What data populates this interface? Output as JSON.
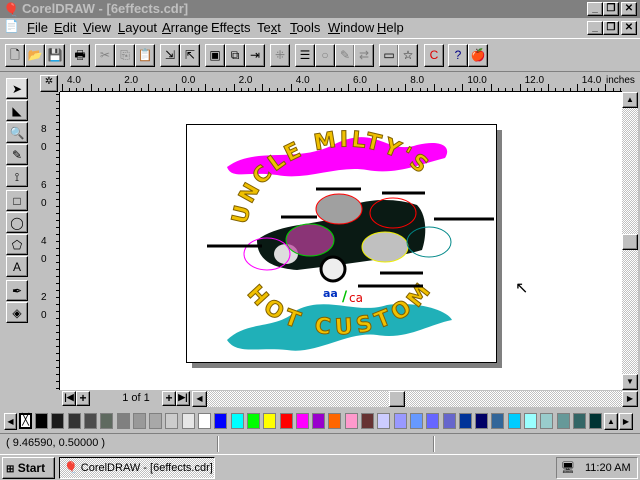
{
  "window": {
    "title": "CorelDRAW - [6effects.cdr]"
  },
  "menu": [
    "File",
    "Edit",
    "View",
    "Layout",
    "Arrange",
    "Effects",
    "Text",
    "Tools",
    "Window",
    "Help"
  ],
  "menu_underline": [
    "F",
    "E",
    "V",
    "L",
    "A",
    "c",
    "x",
    "T",
    "W",
    "H"
  ],
  "toolbar": [
    "new-icon",
    "open-icon",
    "save-icon",
    "print-icon",
    "cut-icon",
    "copy-icon",
    "paste-icon",
    "import-icon",
    "export-icon",
    "wireframe-icon",
    "full-screen-preview-icon",
    "preview-selected-icon",
    "snap-to-grid-icon",
    "roll-up-icon",
    "ellipse-roll-up-icon",
    "pen-roll-up-icon",
    "transform-roll-up-icon",
    "dialog-icon",
    "symbols-icon",
    "corel-apps-icon",
    "whats-this-icon",
    "tutor-icon"
  ],
  "toolbox": [
    "pick-tool",
    "shape-tool",
    "zoom-tool",
    "freehand-tool",
    "dimension-tool",
    "rectangle-tool",
    "ellipse-tool",
    "polygon-tool",
    "text-tool",
    "outline-tool",
    "fill-tool"
  ],
  "ruler": {
    "top_labels": [
      "4.0",
      "2.0",
      "0.0",
      "2.0",
      "4.0",
      "6.0",
      "8.0",
      "10.0",
      "12.0",
      "14.0"
    ],
    "unit": "inches",
    "left_labels": [
      "8",
      "6",
      "4",
      "2"
    ],
    "left_sub": [
      "0",
      "0",
      "0",
      "0"
    ]
  },
  "artwork": {
    "top_text": "UNCLE MILTY'S",
    "bottom_text": "HOT CUSTOM",
    "colors": {
      "top_wave": "#ff00ff",
      "bottom_wave": "#20b0b8",
      "letters": "#f0c000"
    }
  },
  "page_nav": {
    "label": "1 of 1"
  },
  "palette": [
    "#000000",
    "#1a1a1a",
    "#333333",
    "#4d4d4d",
    "#5f6a60",
    "#808080",
    "#999999",
    "#a8a8a8",
    "#cccccc",
    "#e6e6e6",
    "#ffffff",
    "#0000ff",
    "#00ffff",
    "#00ff00",
    "#ffff00",
    "#ff0000",
    "#ff00ff",
    "#9900cc",
    "#ff6600",
    "#ff99cc",
    "#663333",
    "#ccccff",
    "#9999ff",
    "#6699ff",
    "#6666ff",
    "#6666cc",
    "#003399",
    "#000066",
    "#336699",
    "#00ccff",
    "#99ffff",
    "#99cccc",
    "#669999",
    "#336666",
    "#003333"
  ],
  "status": {
    "coords": "( 9.46590, 0.50000 )"
  },
  "taskbar": {
    "start": "Start",
    "task": "CorelDRAW - [6effects.cdr]",
    "clock": "11:20 AM"
  }
}
